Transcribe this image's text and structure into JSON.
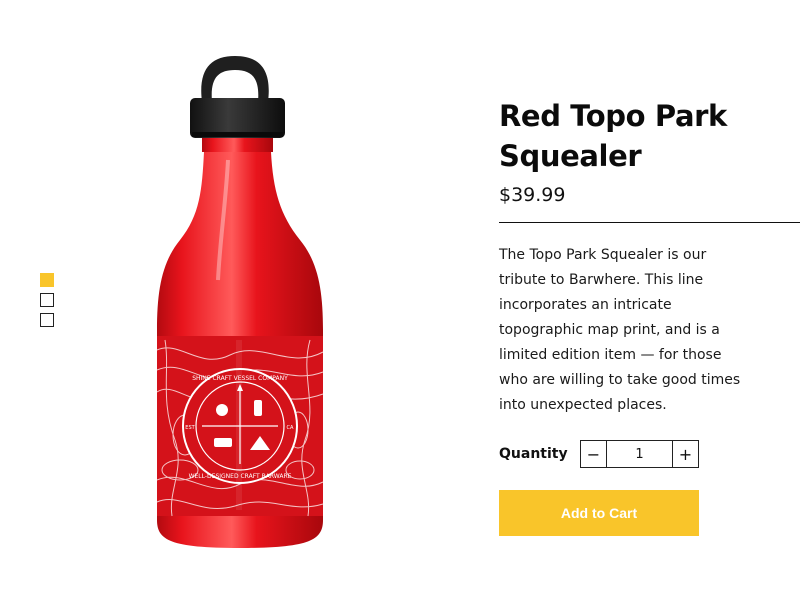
{
  "gallery": {
    "thumbnails": [
      {
        "state": "active"
      },
      {
        "state": "inactive"
      },
      {
        "state": "inactive"
      }
    ],
    "active_index": 0,
    "image": {
      "semantic": "red-water-bottle-image",
      "bottle_color": "#e8141c",
      "cap_color": "#1e1e1e",
      "print_text_top": "SHINE CRAFT VESSEL COMPANY",
      "print_text_bottom": "WELL-DESIGNED CRAFT BARWARE",
      "print_text_side_left": "EST",
      "print_text_side_right": "CA"
    }
  },
  "product": {
    "title": "Red Topo Park Squealer",
    "price": "$39.99",
    "description": "The Topo Park Squealer is our tribute to Barwhere. This line incorporates an intricate topographic map print, and is a limited edition item — for those who are willing to take good times into unexpected places."
  },
  "quantity": {
    "label": "Quantity",
    "value": "1",
    "minus_symbol": "−",
    "plus_symbol": "+"
  },
  "cart": {
    "add_label": "Add to Cart"
  },
  "colors": {
    "accent": "#f9c52a",
    "text": "#111111"
  }
}
